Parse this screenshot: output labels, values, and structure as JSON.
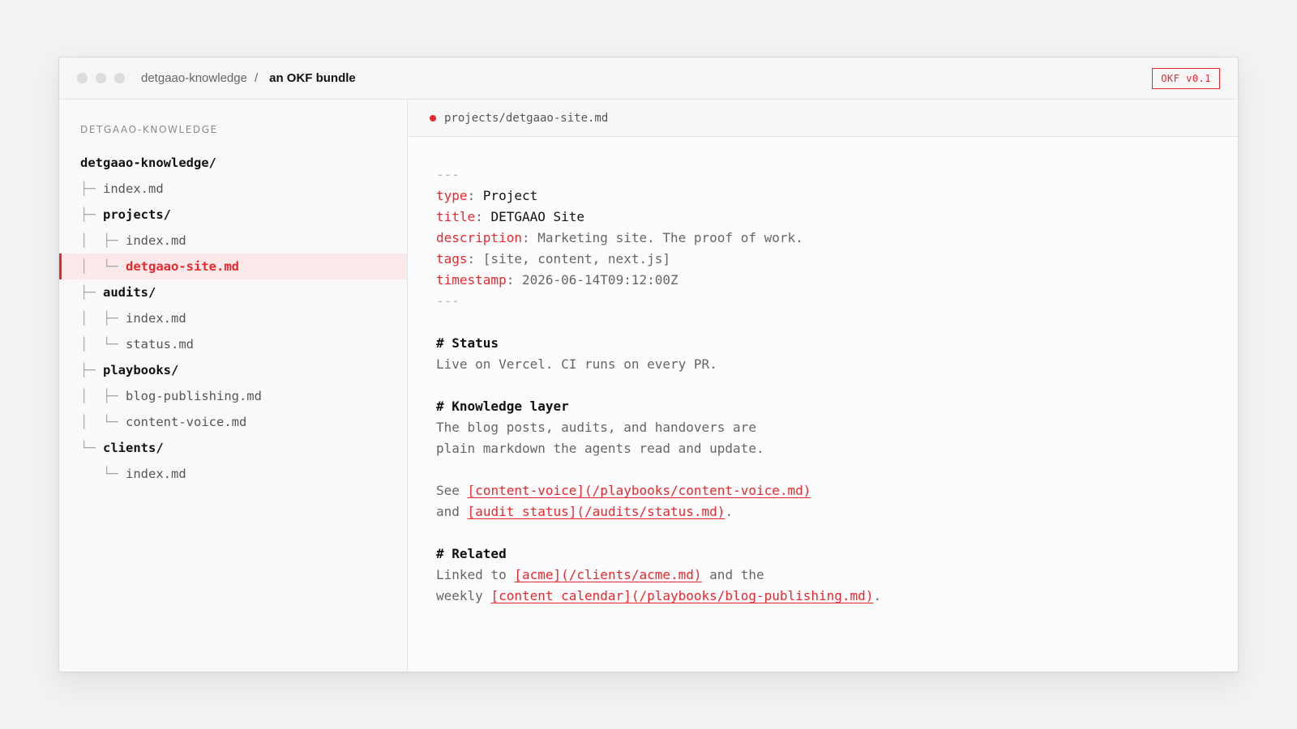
{
  "titlebar": {
    "breadcrumb_root": "detgaao-knowledge",
    "separator": "/",
    "breadcrumb_current": "an OKF bundle",
    "badge": "OKF v0.1"
  },
  "sidebar": {
    "heading": "DETGAAO-KNOWLEDGE",
    "tree": [
      {
        "guide": "",
        "name": "detgaao-knowledge/"
      },
      {
        "guide": "├─ ",
        "name": "index.md"
      },
      {
        "guide": "├─ ",
        "name": "projects/"
      },
      {
        "guide": "│  ├─ ",
        "name": "index.md"
      },
      {
        "guide": "│  └─ ",
        "name": "detgaao-site.md"
      },
      {
        "guide": "├─ ",
        "name": "audits/"
      },
      {
        "guide": "│  ├─ ",
        "name": "index.md"
      },
      {
        "guide": "│  └─ ",
        "name": "status.md"
      },
      {
        "guide": "├─ ",
        "name": "playbooks/"
      },
      {
        "guide": "│  ├─ ",
        "name": "blog-publishing.md"
      },
      {
        "guide": "│  └─ ",
        "name": "content-voice.md"
      },
      {
        "guide": "└─ ",
        "name": "clients/"
      },
      {
        "guide": "   └─ ",
        "name": "index.md"
      }
    ]
  },
  "file_tab": {
    "path": "projects/detgaao-site.md"
  },
  "document": {
    "fence": "---",
    "frontmatter": {
      "type_key": "type",
      "type_val": "Project",
      "title_key": "title",
      "title_val": "DETGAAO Site",
      "description_key": "description",
      "description_val": "Marketing site. The proof of work.",
      "tags_key": "tags",
      "tags_val": "[site, content, next.js]",
      "timestamp_key": "timestamp",
      "timestamp_val": "2026-06-14T09:12:00Z"
    },
    "status_heading": "# Status",
    "status_text": "Live on Vercel. CI runs on every PR.",
    "knowledge_heading": "# Knowledge layer",
    "knowledge_line1": "The blog posts, audits, and handovers are",
    "knowledge_line2": "plain markdown the agents read and update.",
    "see_word": "See",
    "see_link": "[content-voice](/playbooks/content-voice.md)",
    "and_word": "and",
    "and_link": "[audit status](/audits/status.md)",
    "and_tail": ".",
    "related_heading": "# Related",
    "related_pre": "Linked to",
    "related_link1": "[acme](/clients/acme.md)",
    "related_mid": "and the",
    "related_pre2": "weekly",
    "related_link2": "[content calendar](/playbooks/blog-publishing.md)",
    "related_tail": "."
  },
  "colors": {
    "accent": "#e8282e",
    "active_row_bg": "#fbe9e9"
  }
}
